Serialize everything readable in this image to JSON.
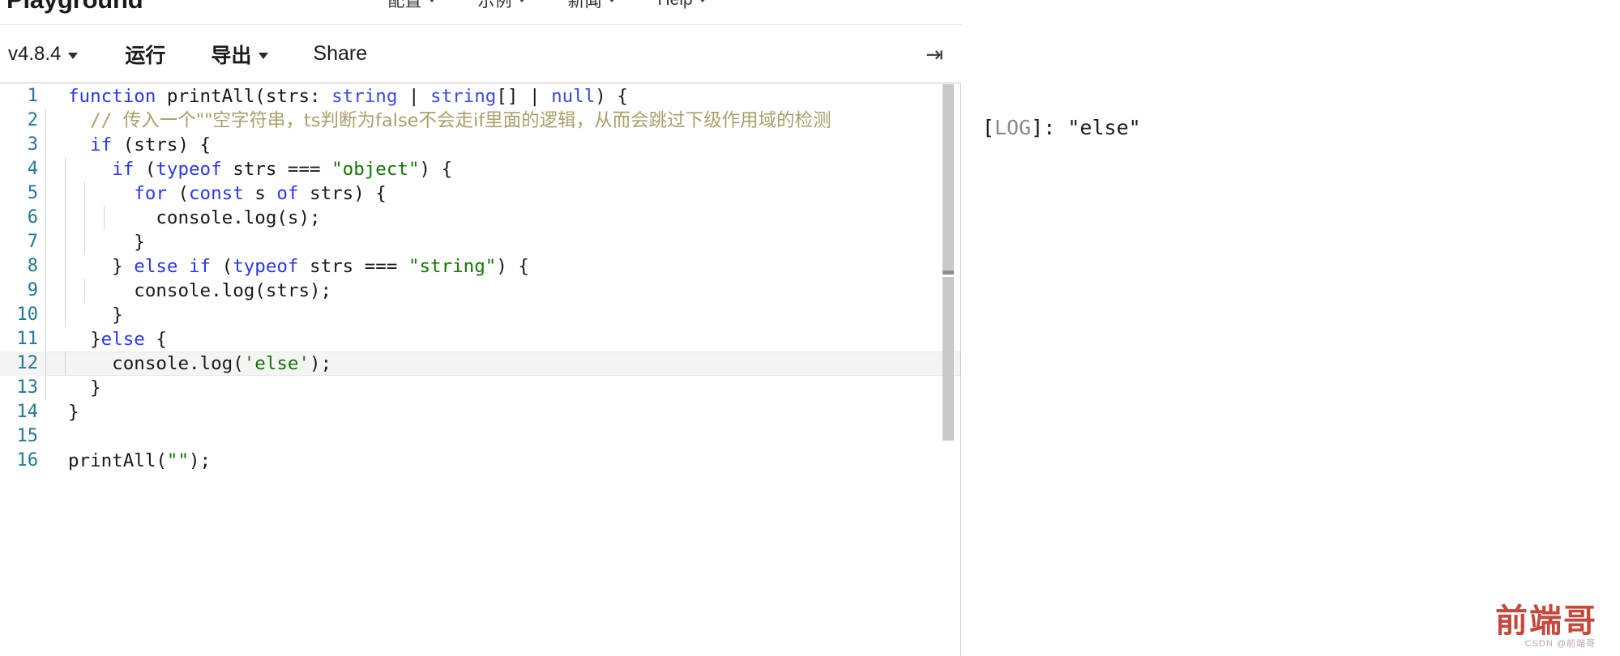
{
  "topnav": {
    "brand": "Playground",
    "items": [
      {
        "label": "配置",
        "has_caret": true
      },
      {
        "label": "示例",
        "has_caret": true
      },
      {
        "label": "新闻",
        "has_caret": true
      },
      {
        "label": "Help",
        "has_caret": true
      }
    ]
  },
  "toolbar": {
    "version": "v4.8.4",
    "run_label": "运行",
    "export_label": "导出",
    "share_label": "Share",
    "collapse_icon": "→|",
    "collapse_glyph": "⇥"
  },
  "editor": {
    "lines": [
      {
        "n": "1",
        "guides": 0,
        "tokens": [
          {
            "t": "function",
            "c": "kw"
          },
          {
            "t": " printAll(strs: ",
            "c": "plain"
          },
          {
            "t": "string",
            "c": "kw2"
          },
          {
            "t": " | ",
            "c": "plain"
          },
          {
            "t": "string",
            "c": "kw2"
          },
          {
            "t": "[] | ",
            "c": "plain"
          },
          {
            "t": "null",
            "c": "kw2"
          },
          {
            "t": ") {",
            "c": "plain"
          }
        ]
      },
      {
        "n": "2",
        "guides": 1,
        "tokens": [
          {
            "t": "  // ",
            "c": "cmt"
          },
          {
            "t": "传入一个\"\"空字符串，ts判断为false不会走if里面的逻辑，从而会跳过下级作用域的检测",
            "c": "cmt cmt-cn"
          }
        ]
      },
      {
        "n": "3",
        "guides": 1,
        "tokens": [
          {
            "t": "  ",
            "c": "plain"
          },
          {
            "t": "if",
            "c": "kw"
          },
          {
            "t": " (strs) {",
            "c": "plain"
          }
        ]
      },
      {
        "n": "4",
        "guides": 2,
        "tokens": [
          {
            "t": "    ",
            "c": "plain"
          },
          {
            "t": "if",
            "c": "kw"
          },
          {
            "t": " (",
            "c": "plain"
          },
          {
            "t": "typeof",
            "c": "kw"
          },
          {
            "t": " strs === ",
            "c": "plain"
          },
          {
            "t": "\"object\"",
            "c": "str"
          },
          {
            "t": ") {",
            "c": "plain"
          }
        ]
      },
      {
        "n": "5",
        "guides": 3,
        "tokens": [
          {
            "t": "      ",
            "c": "plain"
          },
          {
            "t": "for",
            "c": "kw"
          },
          {
            "t": " (",
            "c": "plain"
          },
          {
            "t": "const",
            "c": "kw"
          },
          {
            "t": " s ",
            "c": "plain"
          },
          {
            "t": "of",
            "c": "kw"
          },
          {
            "t": " strs) {",
            "c": "plain"
          }
        ]
      },
      {
        "n": "6",
        "guides": 4,
        "tokens": [
          {
            "t": "        console.log(s);",
            "c": "plain"
          }
        ]
      },
      {
        "n": "7",
        "guides": 3,
        "tokens": [
          {
            "t": "      }",
            "c": "plain"
          }
        ]
      },
      {
        "n": "8",
        "guides": 2,
        "tokens": [
          {
            "t": "    } ",
            "c": "plain"
          },
          {
            "t": "else",
            "c": "kw"
          },
          {
            "t": " ",
            "c": "plain"
          },
          {
            "t": "if",
            "c": "kw"
          },
          {
            "t": " (",
            "c": "plain"
          },
          {
            "t": "typeof",
            "c": "kw"
          },
          {
            "t": " strs === ",
            "c": "plain"
          },
          {
            "t": "\"string\"",
            "c": "str"
          },
          {
            "t": ") {",
            "c": "plain"
          }
        ]
      },
      {
        "n": "9",
        "guides": 3,
        "tokens": [
          {
            "t": "      console.log(strs);",
            "c": "plain"
          }
        ]
      },
      {
        "n": "10",
        "guides": 2,
        "tokens": [
          {
            "t": "    }",
            "c": "plain"
          }
        ]
      },
      {
        "n": "11",
        "guides": 1,
        "tokens": [
          {
            "t": "  }",
            "c": "plain"
          },
          {
            "t": "else",
            "c": "kw"
          },
          {
            "t": " {",
            "c": "plain"
          }
        ]
      },
      {
        "n": "12",
        "guides": 2,
        "active": true,
        "tokens": [
          {
            "t": "    console.log(",
            "c": "plain"
          },
          {
            "t": "'else'",
            "c": "str"
          },
          {
            "t": ");",
            "c": "plain"
          }
        ]
      },
      {
        "n": "13",
        "guides": 1,
        "tokens": [
          {
            "t": "  }",
            "c": "plain"
          }
        ]
      },
      {
        "n": "14",
        "guides": 0,
        "tokens": [
          {
            "t": "}",
            "c": "plain"
          }
        ]
      },
      {
        "n": "15",
        "guides": 0,
        "tokens": []
      },
      {
        "n": "16",
        "guides": 0,
        "tokens": [
          {
            "t": "printAll(",
            "c": "plain"
          },
          {
            "t": "\"\"",
            "c": "str"
          },
          {
            "t": ");",
            "c": "plain"
          }
        ]
      }
    ]
  },
  "output": {
    "log_tag": "LOG",
    "log_prefix": "[",
    "log_suffix": "]: ",
    "log_value": "\"else\""
  },
  "watermark": {
    "text": "前端哥",
    "sub": "CSDN @前端哥"
  },
  "colors": {
    "keyword": "#2a38ef",
    "string": "#117700",
    "comment": "#aaa06a",
    "line_number": "#237893",
    "active_line": "#f4f4f4",
    "watermark": "#c0392b"
  }
}
